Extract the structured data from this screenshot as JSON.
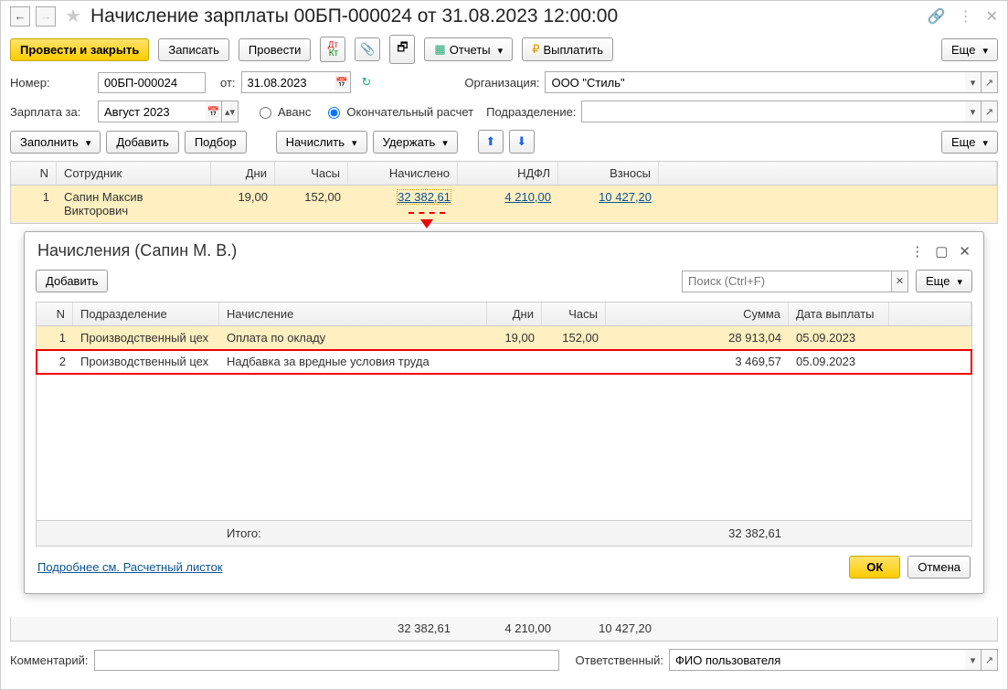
{
  "header": {
    "title": "Начисление зарплаты 00БП-000024 от 31.08.2023 12:00:00"
  },
  "toolbar": {
    "post_close": "Провести и закрыть",
    "write": "Записать",
    "post": "Провести",
    "reports": "Отчеты",
    "pay": "Выплатить",
    "more": "Еще"
  },
  "form": {
    "number_label": "Номер:",
    "number": "00БП-000024",
    "from_label": "от:",
    "date": "31.08.2023",
    "org_label": "Организация:",
    "org": "ООО \"Стиль\"",
    "salary_for_label": "Зарплата за:",
    "salary_for": "Август 2023",
    "advance": "Аванс",
    "final": "Окончательный расчет",
    "department_label": "Подразделение:",
    "department": ""
  },
  "actions": {
    "fill": "Заполнить",
    "add": "Добавить",
    "pick": "Подбор",
    "charge": "Начислить",
    "withhold": "Удержать",
    "more": "Еще"
  },
  "grid": {
    "cols": {
      "n": "N",
      "emp": "Сотрудник",
      "days": "Дни",
      "hours": "Часы",
      "charged": "Начислено",
      "ndfl": "НДФЛ",
      "contrib": "Взносы"
    },
    "rows": [
      {
        "n": "1",
        "emp": "Сапин Максив Викторович",
        "days": "19,00",
        "hours": "152,00",
        "charged": "32 382,61",
        "ndfl": "4 210,00",
        "contrib": "10 427,20"
      }
    ],
    "totals": {
      "charged": "32 382,61",
      "ndfl": "4 210,00",
      "contrib": "10 427,20"
    }
  },
  "popover": {
    "title": "Начисления (Сапин М. В.)",
    "add": "Добавить",
    "search_ph": "Поиск (Ctrl+F)",
    "more": "Еще",
    "cols": {
      "n": "N",
      "dept": "Подразделение",
      "charge": "Начисление",
      "days": "Дни",
      "hours": "Часы",
      "sum": "Сумма",
      "date": "Дата выплаты"
    },
    "rows": [
      {
        "n": "1",
        "dept": "Производственный цех",
        "charge": "Оплата по окладу",
        "days": "19,00",
        "hours": "152,00",
        "sum": "28 913,04",
        "date": "05.09.2023"
      },
      {
        "n": "2",
        "dept": "Производственный цех",
        "charge": "Надбавка за вредные условия труда",
        "days": "",
        "hours": "",
        "sum": "3 469,57",
        "date": "05.09.2023"
      }
    ],
    "total_label": "Итого:",
    "total_sum": "32 382,61",
    "details_link": "Подробнее см. Расчетный листок",
    "ok": "ОК",
    "cancel": "Отмена"
  },
  "footer": {
    "comment_label": "Комментарий:",
    "comment": "",
    "resp_label": "Ответственный:",
    "resp": "ФИО пользователя"
  }
}
